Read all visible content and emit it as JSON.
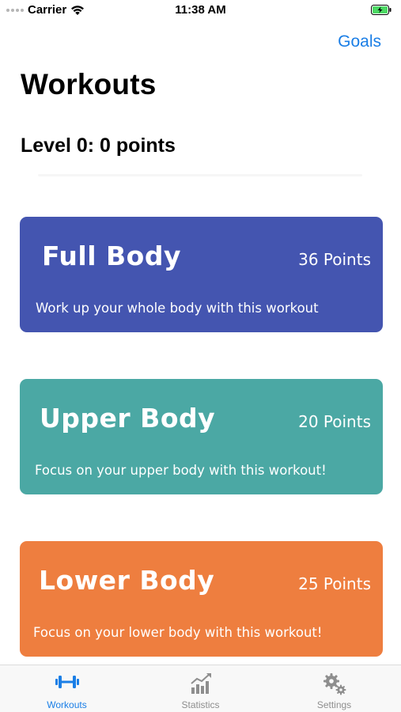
{
  "status_bar": {
    "carrier": "Carrier",
    "time": "11:38 AM"
  },
  "nav": {
    "right_link": "Goals"
  },
  "page": {
    "title": "Workouts",
    "level": "Level 0: 0 points"
  },
  "workouts": [
    {
      "title": "Full Body",
      "points": "36 Points",
      "description": "Work up your whole body with this workout",
      "color": "#4455b0"
    },
    {
      "title": "Upper Body",
      "points": "20 Points",
      "description": "Focus on your upper body with this workout!",
      "color": "#4ba8a4"
    },
    {
      "title": "Lower Body",
      "points": "25 Points",
      "description": "Focus on your lower body with this workout!",
      "color": "#ee7e3f"
    }
  ],
  "tabs": [
    {
      "label": "Workouts",
      "icon": "dumbbell-icon",
      "active": true
    },
    {
      "label": "Statistics",
      "icon": "chart-icon",
      "active": false
    },
    {
      "label": "Settings",
      "icon": "gears-icon",
      "active": false
    }
  ],
  "colors": {
    "accent": "#1a7ee6",
    "inactive_tab": "#8e8e8e"
  }
}
